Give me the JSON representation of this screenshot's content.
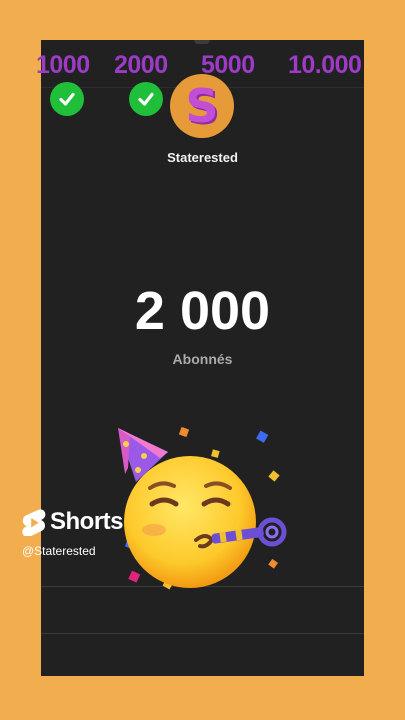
{
  "milestones": [
    {
      "label": "1000",
      "achieved": true
    },
    {
      "label": "2000",
      "achieved": true
    },
    {
      "label": "5000",
      "achieved": false
    },
    {
      "label": "10.000",
      "achieved": false
    }
  ],
  "channel": {
    "avatar_letter": "S",
    "name": "Staterested"
  },
  "subscribers": {
    "count": "2 000",
    "label": "Abonnés"
  },
  "shorts": {
    "label": "Shorts",
    "handle": "@Staterested"
  },
  "colors": {
    "background": "#F2AE4E",
    "panel": "#212121",
    "milestone_text": "#9B3BC6",
    "check": "#1FBF3A",
    "avatar_bg": "#E79A38",
    "avatar_letter": "#C24FD3"
  },
  "icons": [
    "check-icon",
    "shorts-logo-icon",
    "partying-face-emoji"
  ]
}
